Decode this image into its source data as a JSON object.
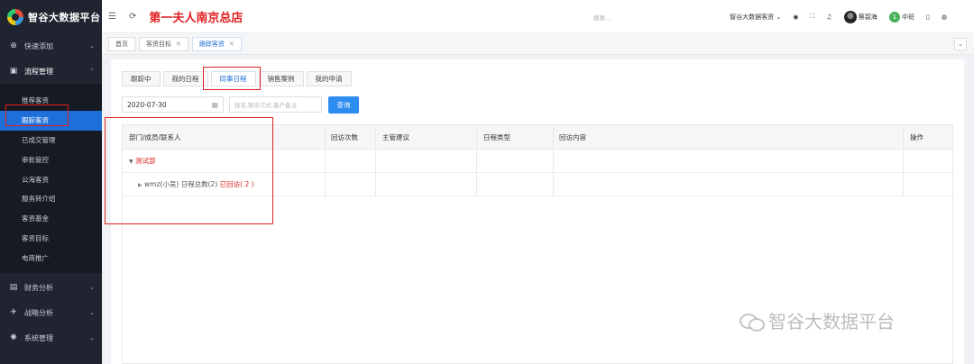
{
  "app": {
    "logo_text": "智谷大数据平台",
    "store_title": "第一夫人南京总店"
  },
  "sidebar": {
    "groups": [
      {
        "label": "快速添加",
        "icon": "plus-circle-icon"
      },
      {
        "label": "流程管理",
        "icon": "briefcase-icon"
      },
      {
        "label": "财务分析",
        "icon": "chart-icon"
      },
      {
        "label": "战略分析",
        "icon": "plane-icon"
      },
      {
        "label": "系统管理",
        "icon": "settings-icon"
      }
    ],
    "items": [
      {
        "label": "推荐客资"
      },
      {
        "label": "跟踪客资"
      },
      {
        "label": "已成交管理"
      },
      {
        "label": "审批管控"
      },
      {
        "label": "公海客资"
      },
      {
        "label": "服务转介绍"
      },
      {
        "label": "客资基金"
      },
      {
        "label": "客资目标"
      },
      {
        "label": "电商推广"
      }
    ]
  },
  "header": {
    "search_placeholder": "搜索...",
    "org_select": "智谷大数据客资",
    "user_name": "蔡碧海",
    "shift": "中班",
    "shift_avatar": "1"
  },
  "page_tabs": [
    {
      "label": "首页"
    },
    {
      "label": "客资目标"
    },
    {
      "label": "跟踪客资"
    }
  ],
  "sub_tabs": [
    {
      "label": "跟踪中"
    },
    {
      "label": "我的日程"
    },
    {
      "label": "同事日程"
    },
    {
      "label": "销售案例"
    },
    {
      "label": "我的申请"
    }
  ],
  "filters": {
    "date": "2020-07-30",
    "keyword_placeholder": "姓名,联系方式,客户备注",
    "query_label": "查询"
  },
  "table": {
    "columns": [
      "部门/成员/联系人",
      "回访次数",
      "主管建议",
      "日程类型",
      "回访内容",
      "操作"
    ],
    "dept_name": "测试部",
    "person_text": "wmz(小吴) 日程总数(2)",
    "visited_text": "已回访( 2 )"
  },
  "watermark": "智谷大数据平台",
  "colors": {
    "sidebar_bg": "#1f2430",
    "accent": "#1e6fd9",
    "highlight_red": "#e02020"
  }
}
